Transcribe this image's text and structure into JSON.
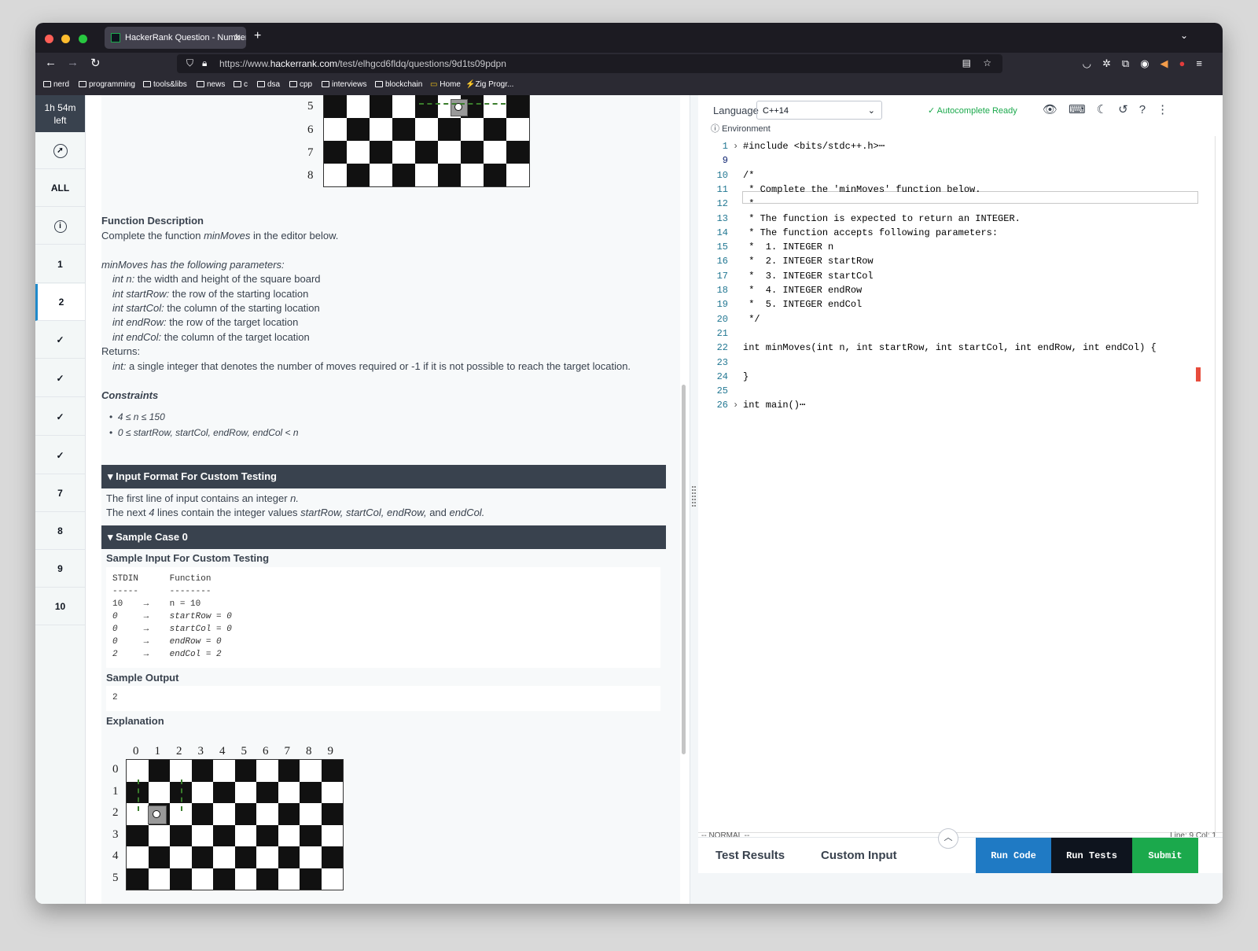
{
  "browser": {
    "tab_title": "HackerRank Question - Number",
    "url_prefix": "https://www.",
    "url_domain": "hackerrank.com",
    "url_path": "/test/elhgcd6fldq/questions/9d1ts09pdpn",
    "bookmarks": [
      "nerd",
      "programming",
      "tools&libs",
      "news",
      "c",
      "dsa",
      "cpp",
      "interviews",
      "blockchain",
      "Home",
      "Zig Progr..."
    ]
  },
  "sidebar": {
    "timer_line1": "1h 54m",
    "timer_line2": "left",
    "items": [
      "ALL",
      "1",
      "2",
      "✓",
      "✓",
      "✓",
      "✓",
      "7",
      "8",
      "9",
      "10"
    ]
  },
  "problem": {
    "top_board_rows": [
      "5",
      "6",
      "7",
      "8"
    ],
    "function_description_heading": "Function Description",
    "complete_text_pre": "Complete the function ",
    "complete_text_fn": "minMoves",
    "complete_text_post": " in the editor below.",
    "params_intro": "minMoves has  the following parameters:",
    "params": [
      {
        "name": "int n:",
        "desc": " the width and height of the square board"
      },
      {
        "name": "int startRow:",
        "desc": " the row of the starting location"
      },
      {
        "name": "int startCol:",
        "desc": " the column of the starting location"
      },
      {
        "name": "int endRow:",
        "desc": " the row of the target location"
      },
      {
        "name": "int endCol:",
        "desc": " the column of the target location"
      }
    ],
    "returns_label": "Returns:",
    "returns_type": "int:",
    "returns_desc": " a single integer that denotes the number of moves required or -1 if it is not possible to reach the target location.",
    "constraints_heading": "Constraints",
    "constraints": [
      "4 ≤ n ≤ 150",
      "0 ≤ startRow, startCol, endRow, endCol < n"
    ],
    "input_format_heading": "▾ Input Format For Custom Testing",
    "input_format_line1_pre": "The first line of input contains an integer ",
    "input_format_line1_var": "n.",
    "input_format_line2_pre": "The next ",
    "input_format_line2_num": "4",
    "input_format_line2_mid": " lines contain the integer values ",
    "input_format_line2_vars": "startRow, startCol, endRow,",
    "input_format_line2_and": " and ",
    "input_format_line2_last": "endCol.",
    "sample_case_heading": "▾ Sample Case 0",
    "sample_input_heading": "Sample Input For Custom Testing",
    "sample_input_lines": [
      "STDIN      Function",
      "-----      --------",
      "10    →    n = 10",
      "0     →    startRow = 0",
      "0     →    startCol = 0",
      "0     →    endRow = 0",
      "2     →    endCol = 2"
    ],
    "sample_output_heading": "Sample Output",
    "sample_output_value": "2",
    "explanation_heading": "Explanation",
    "expl_cols": [
      "0",
      "1",
      "2",
      "3",
      "4",
      "5",
      "6",
      "7",
      "8",
      "9"
    ],
    "expl_rows": [
      "0",
      "1",
      "2",
      "3",
      "4",
      "5"
    ]
  },
  "editor": {
    "language_label": "Language",
    "language_value": "C++14",
    "environment_label": "Environment",
    "autocomplete_status": "Autocomplete Ready",
    "code_lines": [
      {
        "no": "1",
        "fold": "›",
        "text": "#include <bits/stdc++.h>⋯"
      },
      {
        "no": "9",
        "fold": "",
        "text": ""
      },
      {
        "no": "10",
        "fold": "",
        "text": "/*"
      },
      {
        "no": "11",
        "fold": "",
        "text": " * Complete the 'minMoves' function below."
      },
      {
        "no": "12",
        "fold": "",
        "text": " *"
      },
      {
        "no": "13",
        "fold": "",
        "text": " * The function is expected to return an INTEGER."
      },
      {
        "no": "14",
        "fold": "",
        "text": " * The function accepts following parameters:"
      },
      {
        "no": "15",
        "fold": "",
        "text": " *  1. INTEGER n"
      },
      {
        "no": "16",
        "fold": "",
        "text": " *  2. INTEGER startRow"
      },
      {
        "no": "17",
        "fold": "",
        "text": " *  3. INTEGER startCol"
      },
      {
        "no": "18",
        "fold": "",
        "text": " *  4. INTEGER endRow"
      },
      {
        "no": "19",
        "fold": "",
        "text": " *  5. INTEGER endCol"
      },
      {
        "no": "20",
        "fold": "",
        "text": " */"
      },
      {
        "no": "21",
        "fold": "",
        "text": ""
      },
      {
        "no": "22",
        "fold": "",
        "text": "int minMoves(int n, int startRow, int startCol, int endRow, int endCol) {"
      },
      {
        "no": "23",
        "fold": "",
        "text": ""
      },
      {
        "no": "24",
        "fold": "",
        "text": "}"
      },
      {
        "no": "25",
        "fold": "",
        "text": ""
      },
      {
        "no": "26",
        "fold": "›",
        "text": "int main()⋯"
      }
    ],
    "vim_mode": "-- NORMAL --",
    "cursor_pos": "Line: 9 Col: 1",
    "tab_test_results": "Test Results",
    "tab_custom_input": "Custom Input",
    "run_code": "Run Code",
    "run_tests": "Run Tests",
    "submit": "Submit"
  },
  "colors": {
    "run_code_bg": "#1f7ac4",
    "run_tests_bg": "#0e141e",
    "submit_bg": "#1ba94c",
    "section_bar_bg": "#39424e"
  }
}
